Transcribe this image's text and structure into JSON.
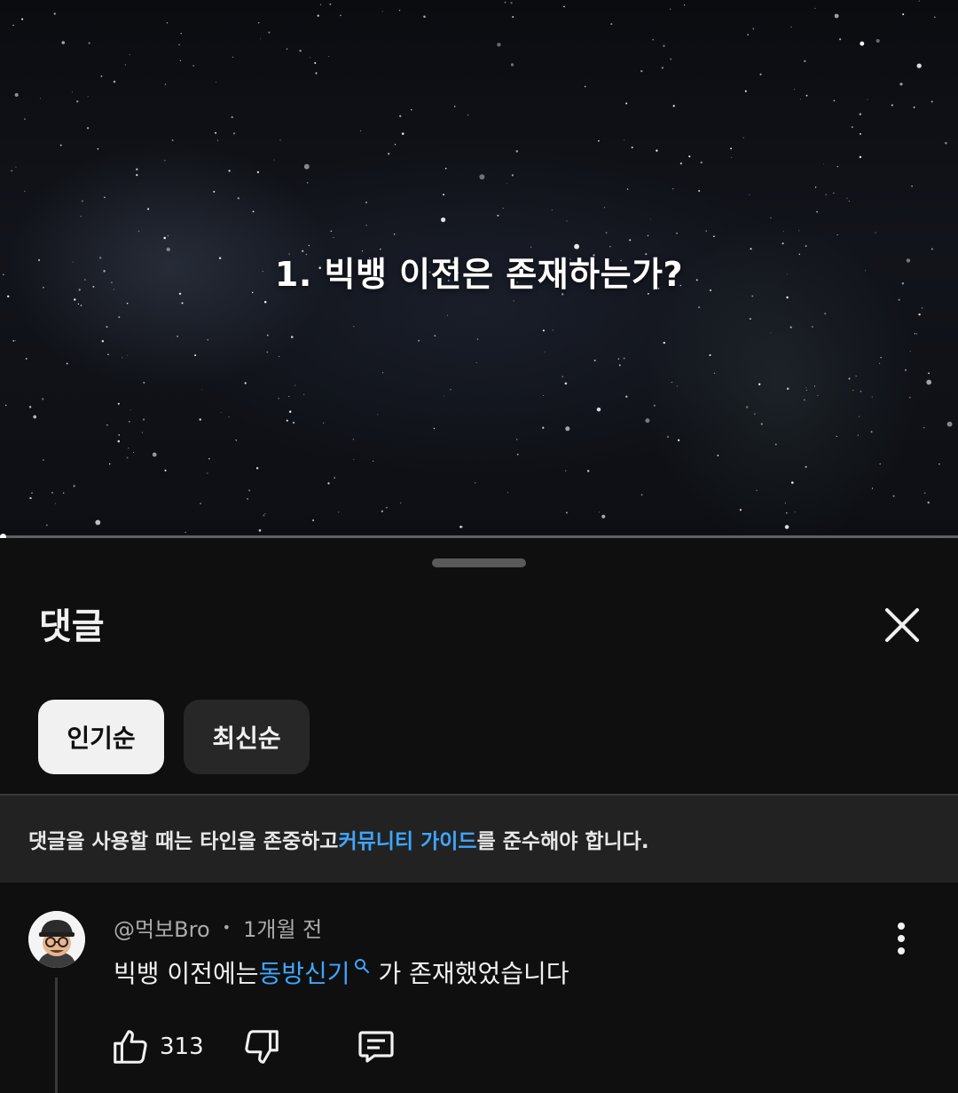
{
  "video": {
    "caption": "1. 빅뱅 이전은 존재하는가?",
    "progress_fraction": 0.003
  },
  "comments_panel": {
    "title": "댓글",
    "close_icon": "close-icon",
    "sort_chips": [
      {
        "label": "인기순",
        "selected": true
      },
      {
        "label": "최신순",
        "selected": false
      }
    ],
    "guideline": {
      "before": "댓글을 사용할 때는 타인을 존중하고 ",
      "link": "커뮤니티 가이드",
      "after": "를 준수해야 합니다."
    }
  },
  "comment": {
    "author": "@먹보Bro",
    "time": "1개월 전",
    "text_before": "빅뱅 이전에는 ",
    "text_link": "동방신기",
    "text_after": "가 존재했었습니다",
    "likes": "313",
    "icons": [
      "thumbs-up-icon",
      "thumbs-down-icon",
      "reply-icon",
      "more-vert-icon",
      "search-icon"
    ]
  },
  "colors": {
    "background": "#0f0f0f",
    "link": "#3ea6ff",
    "chip_active": "#f1f1f1",
    "chip_inactive": "#272727",
    "banner": "#222222"
  }
}
